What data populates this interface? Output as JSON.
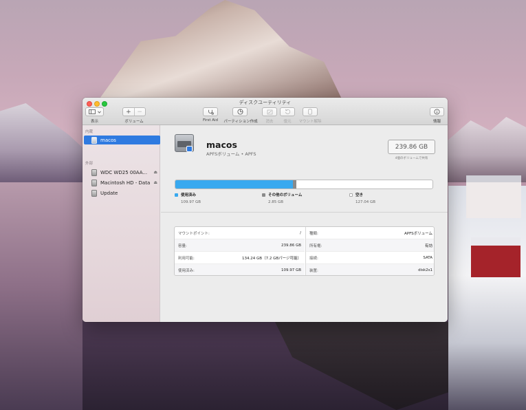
{
  "window": {
    "title": "ディスクユーティリティ"
  },
  "toolbar": {
    "view_label": "表示",
    "volume_label": "ボリューム",
    "volume_add": "+",
    "volume_remove": "−",
    "first_aid_label": "First Aid",
    "partition_label": "パーティション作成",
    "erase_label": "消去",
    "restore_label": "復元",
    "unmount_label": "マウント解除",
    "info_label": "情報"
  },
  "sidebar": {
    "internal_header": "内蔵",
    "external_header": "外部",
    "internal_items": [
      {
        "label": "macos"
      }
    ],
    "external_items": [
      {
        "label": "WDC WD25 00AA..."
      },
      {
        "label": "Macintosh HD - Data"
      },
      {
        "label": "Update"
      }
    ]
  },
  "volume": {
    "name": "macos",
    "subtitle": "APFSボリューム • APFS",
    "size": "239.86 GB",
    "size_caption": "4個のボリュームで共有"
  },
  "usage": {
    "used_fraction": 0.458,
    "other_fraction": 0.012,
    "free_fraction": 0.53,
    "colors": {
      "used": "#38a9ef",
      "other": "#8a8a8a",
      "free": "#ffffff"
    },
    "legend": [
      {
        "label": "使用済み",
        "value": "109.97 GB"
      },
      {
        "label": "その他のボリューム",
        "value": "2.85 GB"
      },
      {
        "label": "空き",
        "value": "127.04 GB"
      }
    ]
  },
  "info": {
    "left": [
      {
        "key": "マウントポイント:",
        "value": "/"
      },
      {
        "key": "容量:",
        "value": "239.86 GB"
      },
      {
        "key": "利用可能:",
        "value": "134.24 GB（7.2 GBパージ可能）"
      },
      {
        "key": "使用済み:",
        "value": "109.97 GB"
      }
    ],
    "right": [
      {
        "key": "種類:",
        "value": "APFSボリューム"
      },
      {
        "key": "所有権:",
        "value": "有効"
      },
      {
        "key": "接続:",
        "value": "SATA"
      },
      {
        "key": "装置:",
        "value": "disk2s1"
      }
    ]
  }
}
